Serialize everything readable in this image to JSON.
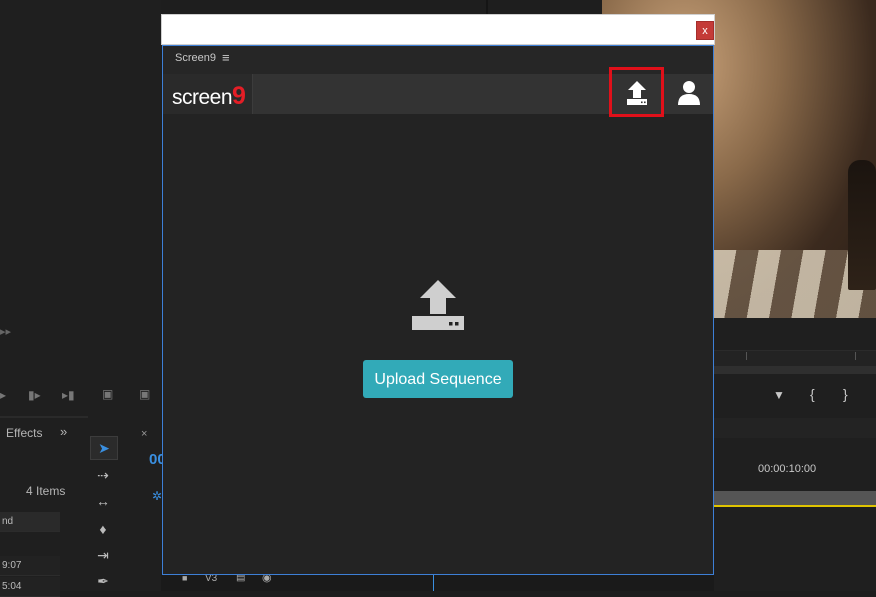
{
  "background": {
    "left_panel": {
      "tab_label": "Effects",
      "items_count": "4 Items",
      "column_header": "nd",
      "rows": [
        "9:07",
        "5:04"
      ]
    },
    "timeline": {
      "timecode_ruler": "00:00:10:00",
      "timecode_partial": "00",
      "track_label": "V3"
    }
  },
  "dialog": {
    "close_label": "x",
    "panel_tab": "Screen9",
    "panel_menu_icon": "hamburger-menu-icon",
    "logo": {
      "text": "screen",
      "digit": "9",
      "brand_color": "#e41e26"
    },
    "header_actions": [
      {
        "name": "upload-icon",
        "highlighted": true
      },
      {
        "name": "user-icon",
        "highlighted": false
      }
    ],
    "main": {
      "icon": "upload-icon",
      "button_label": "Upload Sequence",
      "button_color": "#32aab8"
    }
  }
}
